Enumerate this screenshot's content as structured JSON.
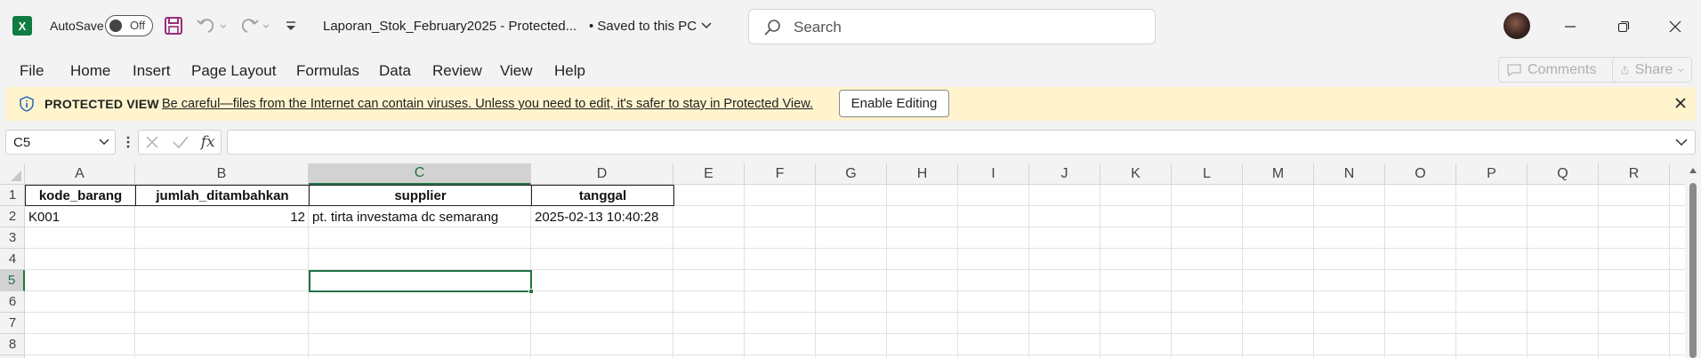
{
  "title_bar": {
    "app_icon_letter": "X",
    "autosave_label": "AutoSave",
    "autosave_state": "Off",
    "doc_title": "Laporan_Stok_February2025  -  Protected...",
    "save_status": "• Saved to this PC",
    "search_placeholder": "Search"
  },
  "menu": {
    "items": [
      "File",
      "Home",
      "Insert",
      "Page Layout",
      "Formulas",
      "Data",
      "Review",
      "View",
      "Help"
    ],
    "comments_label": "Comments",
    "share_label": "Share"
  },
  "protected_view": {
    "title": "PROTECTED VIEW",
    "message": "Be careful—files from the Internet can contain viruses. Unless you need to edit, it's safer to stay in Protected View.",
    "enable_button": "Enable Editing"
  },
  "formula_bar": {
    "name_box": "C5",
    "fx_label": "fx",
    "formula": ""
  },
  "sheet": {
    "columns": [
      "A",
      "B",
      "C",
      "D",
      "E",
      "F",
      "G",
      "H",
      "I",
      "J",
      "K",
      "L",
      "M",
      "N",
      "O",
      "P",
      "Q",
      "R"
    ],
    "rows": [
      "1",
      "2",
      "3",
      "4",
      "5",
      "6",
      "7",
      "8"
    ],
    "selected_cell": "C5",
    "headers": {
      "a": "kode_barang",
      "b": "jumlah_ditambahkan",
      "c": "supplier",
      "d": "tanggal"
    },
    "row2": {
      "a": "K001",
      "b": "12",
      "c": "pt. tirta investama dc semarang",
      "d": "2025-02-13 10:40:28"
    }
  },
  "colors": {
    "excel_green": "#107c41",
    "selection_green": "#217346",
    "protected_bar": "#fff4ce"
  }
}
